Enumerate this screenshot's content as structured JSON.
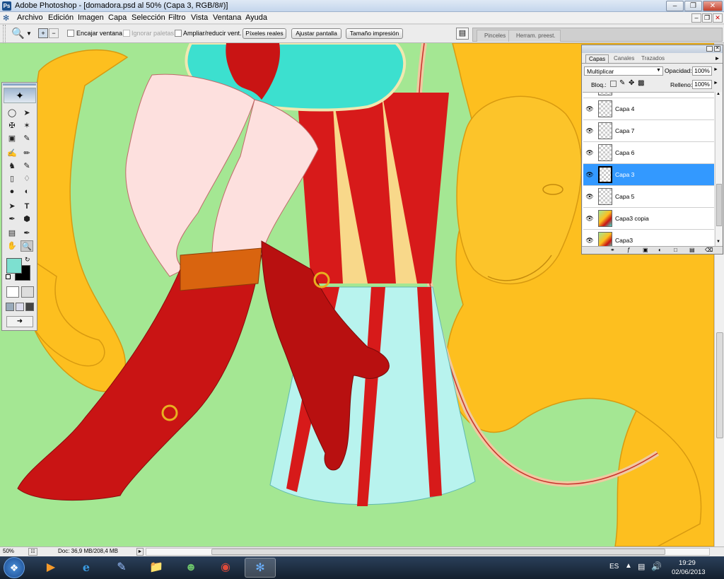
{
  "window": {
    "title": "Adobe Photoshop - [domadora.psd al 50% (Capa 3, RGB/8#)]"
  },
  "menu": [
    "Archivo",
    "Edición",
    "Imagen",
    "Capa",
    "Selección",
    "Filtro",
    "Vista",
    "Ventana",
    "Ayuda"
  ],
  "options": {
    "encajar": "Encajar ventana",
    "ignorar": "Ignorar paletas",
    "ampliar": "Ampliar/reducir vent.",
    "pixeles": "Píxeles reales",
    "ajustar": "Ajustar pantalla",
    "tamano": "Tamaño impresión",
    "well_tabs": [
      "Pinceles",
      "Herram. preest."
    ]
  },
  "layers": {
    "tabs": [
      "Capas",
      "Canales",
      "Trazados"
    ],
    "blend_mode": "Multiplicar",
    "opacity_label": "Opacidad:",
    "opacity": "100%",
    "lock_label": "Bloq.:",
    "fill_label": "Relleno:",
    "fill": "100%",
    "items": [
      {
        "name": "Capa 4",
        "selected": false,
        "thumb": "empty"
      },
      {
        "name": "Capa 7",
        "selected": false,
        "thumb": "empty"
      },
      {
        "name": "Capa 6",
        "selected": false,
        "thumb": "empty"
      },
      {
        "name": "Capa 3",
        "selected": true,
        "thumb": "empty"
      },
      {
        "name": "Capa 5",
        "selected": false,
        "thumb": "empty"
      },
      {
        "name": "Capa3 copia",
        "selected": false,
        "thumb": "figure"
      },
      {
        "name": "Capa3",
        "selected": false,
        "thumb": "figure"
      }
    ]
  },
  "status": {
    "zoom": "50%",
    "doc": "Doc: 36,9 MB/208,4 MB"
  },
  "taskbar": {
    "lang": "ES",
    "time": "19:29",
    "date": "02/06/2013"
  },
  "colors": {
    "canvas_bg": "#a4e793",
    "lion": "#fdbf1f",
    "boot": "#c91414",
    "skirt": "#3ce0cf",
    "foreground": "#7de0d0",
    "background": "#000000",
    "selection": "#3399ff"
  }
}
